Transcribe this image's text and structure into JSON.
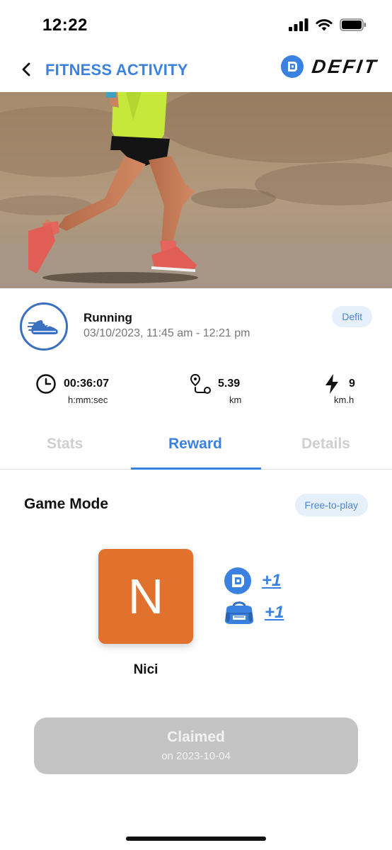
{
  "status_bar": {
    "time": "12:22"
  },
  "header": {
    "title": "FITNESS ACTIVITY",
    "brand_name": "DEFIT",
    "accent": "#3b82e0"
  },
  "activity": {
    "icon": "running-shoe-icon",
    "name": "Running",
    "time_range": "03/10/2023, 11:45 am - 12:21 pm",
    "source": "Defit"
  },
  "metrics": {
    "duration": {
      "icon": "clock-icon",
      "value": "00:36:07",
      "unit": "h:mm:sec"
    },
    "distance": {
      "icon": "route-icon",
      "value": "5.39",
      "unit": "km"
    },
    "speed": {
      "icon": "lightning-icon",
      "value": "9",
      "unit": "km.h"
    }
  },
  "tabs": [
    {
      "label": "Stats",
      "active": false
    },
    {
      "label": "Reward",
      "active": true
    },
    {
      "label": "Details",
      "active": false
    }
  ],
  "reward": {
    "section_title": "Game Mode",
    "mode": "Free-to-play",
    "avatar_letter": "N",
    "avatar_color": "#e0722d",
    "avatar_name": "Nici",
    "items": [
      {
        "icon": "defit-token-icon",
        "amount": "+1"
      },
      {
        "icon": "gym-bag-icon",
        "amount": "+1"
      }
    ]
  },
  "claim": {
    "label": "Claimed",
    "date": "on 2023-10-04"
  }
}
